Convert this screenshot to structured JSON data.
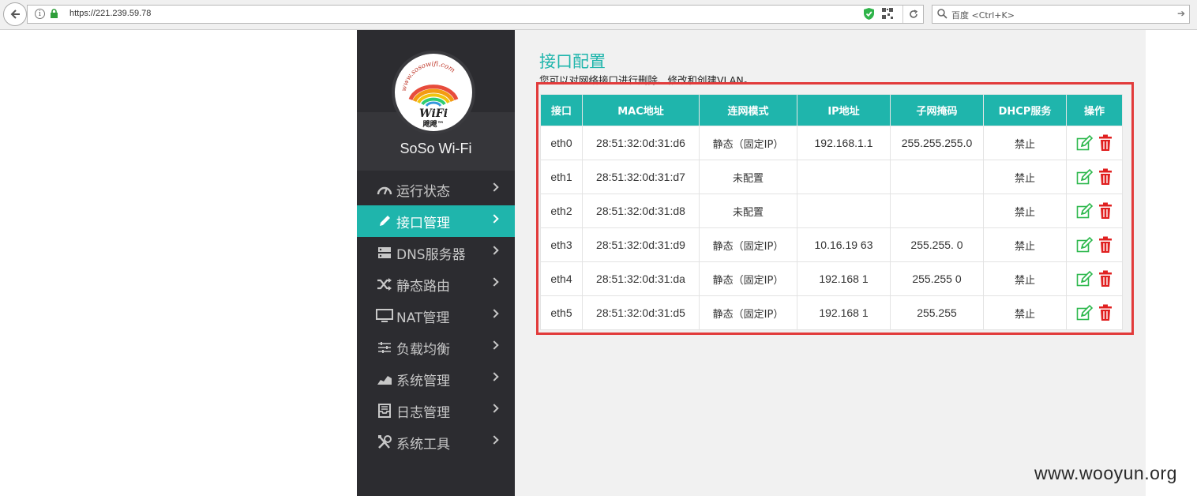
{
  "browser": {
    "url": "https://221.239.59.78",
    "search_placeholder": "百度 <Ctrl+K>"
  },
  "sidebar": {
    "logo_url_text": "www.sosowifi.com",
    "logo_wordmark": "WiFi",
    "logo_subtext": "飕飕™",
    "brand_name": "SoSo Wi-Fi",
    "items": [
      {
        "label": "运行状态",
        "icon": "speedometer-icon",
        "active": false
      },
      {
        "label": "接口管理",
        "icon": "pencil-icon",
        "active": true
      },
      {
        "label": "DNS服务器",
        "icon": "server-icon",
        "active": false
      },
      {
        "label": "静态路由",
        "icon": "shuffle-icon",
        "active": false
      },
      {
        "label": "NAT管理",
        "icon": "monitor-icon",
        "active": false
      },
      {
        "label": "负载均衡",
        "icon": "sliders-icon",
        "active": false
      },
      {
        "label": "系统管理",
        "icon": "area-chart-icon",
        "active": false
      },
      {
        "label": "日志管理",
        "icon": "inbox-icon",
        "active": false
      },
      {
        "label": "系统工具",
        "icon": "tools-icon",
        "active": false
      }
    ]
  },
  "main": {
    "title": "接口配置",
    "description": "您可以对网络接口进行删除、修改和创建VLAN。",
    "table": {
      "headers": [
        "接口",
        "MAC地址",
        "连网模式",
        "IP地址",
        "子网掩码",
        "DHCP服务",
        "操作"
      ],
      "rows": [
        {
          "iface": "eth0",
          "mac": "28:51:32:0d:31:d6",
          "mode": "静态（固定IP）",
          "ip": "192.168.1.1",
          "mask": "255.255.255.0",
          "dhcp": "禁止"
        },
        {
          "iface": "eth1",
          "mac": "28:51:32:0d:31:d7",
          "mode": "未配置",
          "ip": "",
          "mask": "",
          "dhcp": "禁止"
        },
        {
          "iface": "eth2",
          "mac": "28:51:32:0d:31:d8",
          "mode": "未配置",
          "ip": "",
          "mask": "",
          "dhcp": "禁止"
        },
        {
          "iface": "eth3",
          "mac": "28:51:32:0d:31:d9",
          "mode": "静态（固定IP）",
          "ip": "10.16.19 63",
          "mask": "255.255. 0",
          "dhcp": "禁止"
        },
        {
          "iface": "eth4",
          "mac": "28:51:32:0d:31:da",
          "mode": "静态（固定IP）",
          "ip": "192.168 1",
          "mask": "255.255 0",
          "dhcp": "禁止"
        },
        {
          "iface": "eth5",
          "mac": "28:51:32:0d:31:d5",
          "mode": "静态（固定IP）",
          "ip": "192.168 1",
          "mask": "255.255",
          "dhcp": "禁止"
        }
      ]
    }
  },
  "watermark": "www.wooyun.org",
  "colors": {
    "accent": "#1fb5ac",
    "sidebar_bg": "#2c2c30",
    "highlight_border": "#e23b3b",
    "edit_icon": "#2db84d",
    "delete_icon": "#e02020"
  }
}
